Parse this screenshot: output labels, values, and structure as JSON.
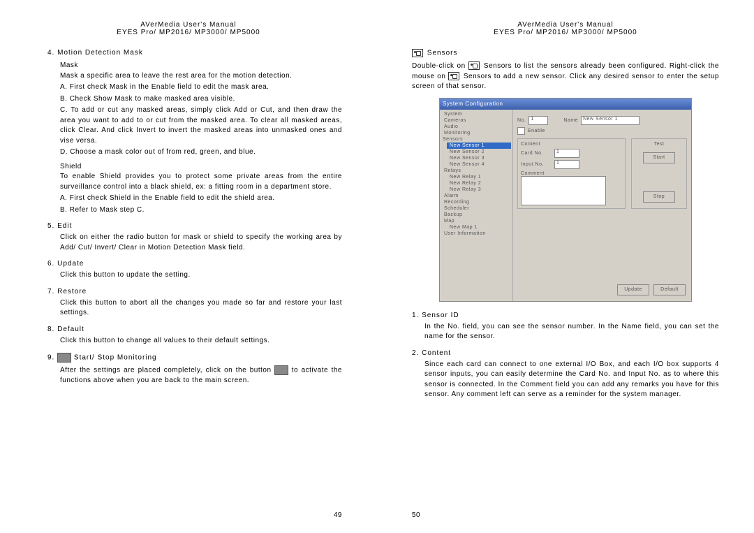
{
  "header": {
    "line1": "AVerMedia User's Manual",
    "line2": "EYES Pro/ MP2016/ MP3000/ MP5000"
  },
  "left": {
    "s4_title": "4.  Motion Detection Mask",
    "mask_label": "Mask",
    "mask_desc": "Mask a specific area to leave the rest area for the motion detection.",
    "mask_a": "A.  First check Mask in the Enable field to edit the mask area.",
    "mask_b": "B.  Check Show Mask to make masked area visible.",
    "mask_c": "C.  To add or cut any masked areas, simply click Add or Cut, and then draw the area you want to add to or cut from the masked area.  To clear all masked areas, click Clear. And click Invert to invert the masked areas into unmasked ones and vise versa.",
    "mask_d": "D.  Choose a mask color out of from red, green, and blue.",
    "shield_label": "Shield",
    "shield_desc": "To enable Shield provides you to protect some private areas from the entire surveillance control into a black shield, ex: a fitting room in a department store.",
    "shield_a": "A.  First check Shield in the Enable field to edit the shield area.",
    "shield_b": "B.  Refer to Mask step C.",
    "s5_title": "5.  Edit",
    "s5_body": "Click on either the radio button for mask or shield to specify the working area by Add/ Cut/ Invert/ Clear in Motion Detection Mask field.",
    "s6_title": "6.  Update",
    "s6_body": "Click this button to update the setting.",
    "s7_title": "7.  Restore",
    "s7_body": "Click this button to abort all the changes you made so far and restore your last settings.",
    "s8_title": "8.  Default",
    "s8_body": "Click this button to change all values to their default settings.",
    "s9_prefix": "9.  ",
    "s9_title": " Start/ Stop Monitoring",
    "s9_body_a": "After the settings are placed completely, click on the button ",
    "s9_body_b": " to activate the functions above when you are back to the main screen.",
    "page_number": "49"
  },
  "right": {
    "sensors_title": " Sensors",
    "sensors_p1a": "Double-click on ",
    "sensors_p1b": " Sensors to list the sensors already been configured. Right-click the mouse on ",
    "sensors_p1c": " Sensors to add a new sensor.  Click any desired sensor to enter the setup screen of that sensor.",
    "screenshot": {
      "window_title": "System Configuration",
      "tree": [
        "System",
        "Cameras",
        "Audio",
        "Monitoring",
        "Sensors",
        "New Sensor 1",
        "New Sensor 2",
        "New Sensor 3",
        "New Sensor 4",
        "Relays",
        "New Relay 1",
        "New Relay 2",
        "New Relay 3",
        "Alarm",
        "Recording",
        "Scheduler",
        "Backup",
        "Map",
        "New Map 1",
        "User Information"
      ],
      "tree_selected": "New Sensor 1",
      "no_label": "No.",
      "no_value": "1",
      "name_label": "Name",
      "name_value": "New Sensor 1",
      "enable_label": "Enable",
      "content_label": "Content",
      "cardno_label": "Card No.",
      "cardno_value": "1",
      "inputno_label": "Input No.",
      "inputno_value": "1",
      "comment_label": "Comment",
      "test_label": "Test",
      "start_btn": "Start",
      "stop_btn": "Stop",
      "update_btn": "Update",
      "default_btn": "Default"
    },
    "s1_title": "1.  Sensor ID",
    "s1_body": "In the No. field, you can see the sensor number.  In the Name field, you can set the name for the sensor.",
    "s2_title": "2.  Content",
    "s2_body": "Since each card can connect to one external I/O Box, and each I/O box supports 4 sensor inputs, you can easily determine the Card No. and Input No. as to where this sensor is connected.  In the Comment field you can add any remarks you have for this sensor. Any comment left can serve as a reminder for the system manager.",
    "page_number": "50"
  }
}
